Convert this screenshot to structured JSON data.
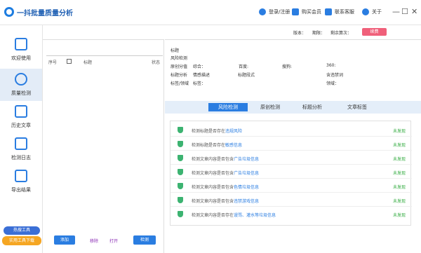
{
  "app": {
    "title": "一抖批量质量分析"
  },
  "titlebar": {
    "login": "登录/注册",
    "buy_vip": "购买会员",
    "contact": "联系客服",
    "about": "关于",
    "min": "—",
    "max": "☐",
    "close": "✕"
  },
  "topinfo": {
    "version": "版本：",
    "expiry": "期限：",
    "remaining": "剩余算次：",
    "upgrade": "续费"
  },
  "sidebar": {
    "items": [
      {
        "label": "欢迎使用",
        "icon": "book-icon"
      },
      {
        "label": "质量检测",
        "icon": "lightning-icon"
      },
      {
        "label": "历史文章",
        "icon": "document-clock-icon"
      },
      {
        "label": "检测日志",
        "icon": "calendar-icon"
      },
      {
        "label": "导出结果",
        "icon": "chart-export-icon"
      }
    ],
    "promo1": "热搜工具",
    "promo2": "实用工具下载"
  },
  "list": {
    "col_index": "序号",
    "col_title": "标题",
    "col_status": "状态",
    "add": "添加",
    "remove": "移除",
    "open": "打开",
    "check": "检测"
  },
  "details": {
    "title_label": "标题",
    "risk_label": "风险检测",
    "original_score": "原创分值",
    "overall": "综合：",
    "baidu": "百度:",
    "sogou": "搜狗:",
    "s360": "360:",
    "title_analysis": "标题分析",
    "emotion_desc": "情感描述",
    "title_style": "标题段式",
    "contains_banned": "含违禁词",
    "tag_field": "标签/领域",
    "tags": "标签：",
    "field": "领域："
  },
  "tabs": [
    {
      "label": "风险检测",
      "active": true
    },
    {
      "label": "原创检测",
      "active": false
    },
    {
      "label": "标题分析",
      "active": false
    },
    {
      "label": "文章标签",
      "active": false
    }
  ],
  "results": [
    {
      "prefix": "检测标题是否存在",
      "highlight": "违规风险",
      "status": "未发现"
    },
    {
      "prefix": "检测标题是否存在",
      "highlight": "敏感信息",
      "status": "未发现"
    },
    {
      "prefix": "检测文章内容是否包含",
      "highlight": "广告垃圾信息",
      "status": "未发现"
    },
    {
      "prefix": "检测文章内容是否包含",
      "highlight": "广告垃圾信息",
      "status": "未发现"
    },
    {
      "prefix": "检测文章内容是否包含",
      "highlight": "色情垃圾信息",
      "status": "未发现"
    },
    {
      "prefix": "检测文章内容是否包含",
      "highlight": "违禁游戏信息",
      "status": "未发现"
    },
    {
      "prefix": "检测文章内容是否存在",
      "highlight": "谩骂、灌水等垃圾信息",
      "status": "未发现"
    }
  ],
  "colors": {
    "accent": "#2a7de1",
    "upgrade": "#f0607a",
    "ok": "#2faa3c",
    "promo_orange": "#f5a623"
  }
}
